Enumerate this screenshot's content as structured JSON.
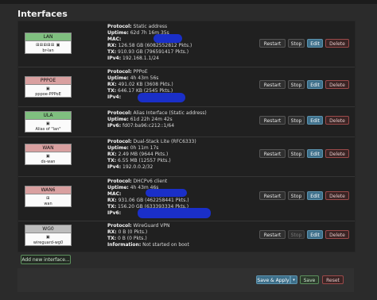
{
  "page": {
    "title": "Interfaces"
  },
  "interfaces": [
    {
      "name": "LAN",
      "color": "#7fbf7f",
      "icons": "⊞⊞⊞⊞⊞ ▣",
      "device": "br-lan",
      "lines": [
        {
          "label": "Protocol:",
          "value": "Static address"
        },
        {
          "label": "Uptime:",
          "value": "62d 7h 16m 35s"
        },
        {
          "label": "MAC:",
          "value": ""
        },
        {
          "label": "RX:",
          "value": "126.58 GB (6082552812 Pkts.)"
        },
        {
          "label": "TX:",
          "value": "910.93 GB (796591417 Pkts.)"
        },
        {
          "label": "IPv4:",
          "value": "192.168.1.1/24"
        }
      ],
      "buttons": {
        "restart": "Restart",
        "stop": "Stop",
        "edit": "Edit",
        "delete": "Delete"
      }
    },
    {
      "name": "PPPOE",
      "color": "#d9a0a0",
      "icons": "▣",
      "device": "pppoe-PPPoE",
      "lines": [
        {
          "label": "Protocol:",
          "value": "PPPoE"
        },
        {
          "label": "Uptime:",
          "value": "4h 43m 56s"
        },
        {
          "label": "RX:",
          "value": "491.02 KB (3608 Pkts.)"
        },
        {
          "label": "TX:",
          "value": "646.17 KB (2545 Pkts.)"
        },
        {
          "label": "IPv4:",
          "value": ""
        }
      ],
      "buttons": {
        "restart": "Restart",
        "stop": "Stop",
        "edit": "Edit",
        "delete": "Delete"
      }
    },
    {
      "name": "ULA",
      "color": "#7fbf7f",
      "icons": "▣",
      "device": "Alias of \"lan\"",
      "lines": [
        {
          "label": "Protocol:",
          "value": "Alias Interface (Static address)"
        },
        {
          "label": "Uptime:",
          "value": "61d 22h 24m 42s"
        },
        {
          "label": "IPv6:",
          "value": "fd07:ba96:c212::1/64"
        }
      ],
      "buttons": {
        "restart": "Restart",
        "stop": "Stop",
        "edit": "Edit",
        "delete": "Delete"
      }
    },
    {
      "name": "WAN",
      "color": "#d9a0a0",
      "icons": "▣",
      "device": "ds-wan",
      "lines": [
        {
          "label": "Protocol:",
          "value": "Dual-Stack Lite (RFC6333)"
        },
        {
          "label": "Uptime:",
          "value": "0h 11m 17s"
        },
        {
          "label": "RX:",
          "value": "2.49 MB (9644 Pkts.)"
        },
        {
          "label": "TX:",
          "value": "6.55 MB (12557 Pkts.)"
        },
        {
          "label": "IPv4:",
          "value": "192.0.0.2/32"
        }
      ],
      "buttons": {
        "restart": "Restart",
        "stop": "Stop",
        "edit": "Edit",
        "delete": "Delete"
      }
    },
    {
      "name": "WAN6",
      "color": "#d9a0a0",
      "icons": "⊞",
      "device": "wan",
      "lines": [
        {
          "label": "Protocol:",
          "value": "DHCPv6 client"
        },
        {
          "label": "Uptime:",
          "value": "4h 43m 46s"
        },
        {
          "label": "MAC:",
          "value": ""
        },
        {
          "label": "RX:",
          "value": "931.06 GB (462258441 Pkts.)"
        },
        {
          "label": "TX:",
          "value": "156.20 GB (633393334 Pkts.)"
        },
        {
          "label": "IPv6:",
          "value": ""
        }
      ],
      "buttons": {
        "restart": "Restart",
        "stop": "Stop",
        "edit": "Edit",
        "delete": "Delete"
      }
    },
    {
      "name": "WG0",
      "color": "#bdbdbd",
      "icons": "▣",
      "device": "wireguard-wg0",
      "lines": [
        {
          "label": "Protocol:",
          "value": "WireGuard VPN"
        },
        {
          "label": "RX:",
          "value": "0 B (0 Pkts.)"
        },
        {
          "label": "TX:",
          "value": "0 B (0 Pkts.)"
        },
        {
          "label": "Information:",
          "value": "Not started on boot"
        }
      ],
      "buttons": {
        "restart": "Restart",
        "stop": "Stop",
        "edit": "Edit",
        "delete": "Delete"
      }
    }
  ],
  "actions": {
    "add_interface": "Add new interface...",
    "save_apply": "Save & Apply",
    "save_apply_caret": "▾",
    "save": "Save",
    "reset": "Reset"
  }
}
